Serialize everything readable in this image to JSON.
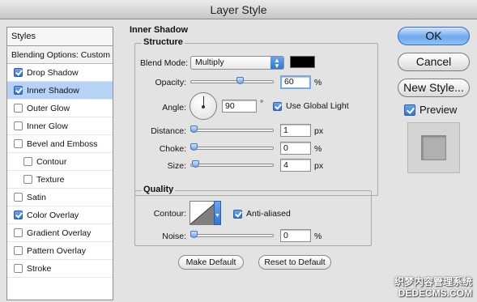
{
  "window": {
    "title": "Layer Style"
  },
  "sidebar": {
    "header": "Styles",
    "blending": "Blending Options: Custom",
    "items": [
      {
        "label": "Drop Shadow",
        "checked": true,
        "indent": false,
        "selected": false
      },
      {
        "label": "Inner Shadow",
        "checked": true,
        "indent": false,
        "selected": true
      },
      {
        "label": "Outer Glow",
        "checked": false,
        "indent": false,
        "selected": false
      },
      {
        "label": "Inner Glow",
        "checked": false,
        "indent": false,
        "selected": false
      },
      {
        "label": "Bevel and Emboss",
        "checked": false,
        "indent": false,
        "selected": false
      },
      {
        "label": "Contour",
        "checked": false,
        "indent": true,
        "selected": false
      },
      {
        "label": "Texture",
        "checked": false,
        "indent": true,
        "selected": false
      },
      {
        "label": "Satin",
        "checked": false,
        "indent": false,
        "selected": false
      },
      {
        "label": "Color Overlay",
        "checked": true,
        "indent": false,
        "selected": false
      },
      {
        "label": "Gradient Overlay",
        "checked": false,
        "indent": false,
        "selected": false
      },
      {
        "label": "Pattern Overlay",
        "checked": false,
        "indent": false,
        "selected": false
      },
      {
        "label": "Stroke",
        "checked": false,
        "indent": false,
        "selected": false
      }
    ]
  },
  "panel": {
    "title": "Inner Shadow",
    "structure": {
      "title": "Structure",
      "blend_mode_label": "Blend Mode:",
      "blend_mode_value": "Multiply",
      "shadow_color": "#000000",
      "opacity_label": "Opacity:",
      "opacity_value": "60",
      "opacity_unit": "%",
      "opacity_level": 0.6,
      "angle_label": "Angle:",
      "angle_value": "90",
      "angle_unit": "°",
      "use_global_light_label": "Use Global Light",
      "use_global_light": true,
      "distance_label": "Distance:",
      "distance_value": "1",
      "distance_unit": "px",
      "choke_label": "Choke:",
      "choke_value": "0",
      "choke_unit": "%",
      "size_label": "Size:",
      "size_value": "4",
      "size_unit": "px"
    },
    "quality": {
      "title": "Quality",
      "contour_label": "Contour:",
      "anti_aliased_label": "Anti-aliased",
      "anti_aliased": true,
      "noise_label": "Noise:",
      "noise_value": "0",
      "noise_unit": "%"
    },
    "make_default": "Make Default",
    "reset_default": "Reset to Default"
  },
  "actions": {
    "ok": "OK",
    "cancel": "Cancel",
    "new_style": "New Style...",
    "preview_label": "Preview",
    "preview": true
  },
  "watermark": {
    "line1": "织梦内容管理系统",
    "line2": "DEDECMS.COM"
  },
  "colors": {
    "selection": "#b6d2f7",
    "accent": "#2f76d8",
    "shadow": "#000000"
  }
}
